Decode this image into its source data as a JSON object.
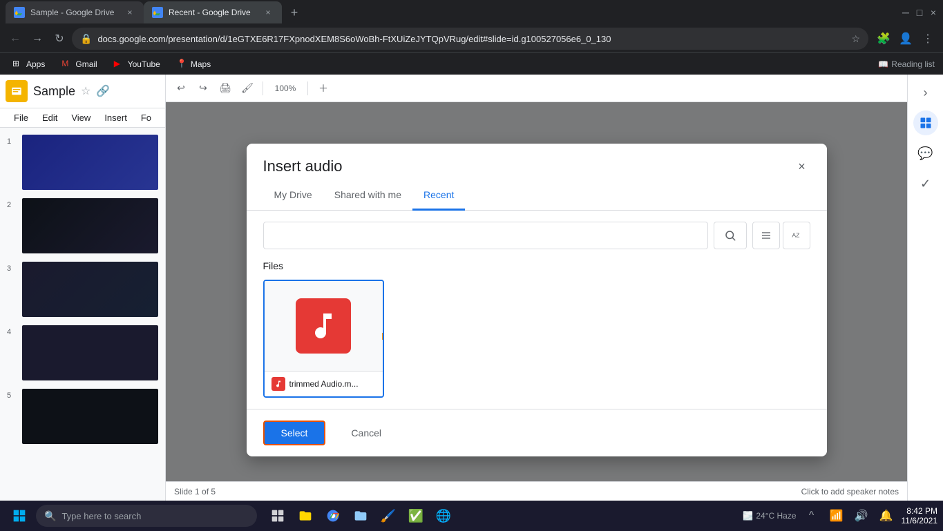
{
  "browser": {
    "tabs": [
      {
        "id": "tab1",
        "title": "Sample - Google Drive",
        "active": false,
        "favicon": "drive"
      },
      {
        "id": "tab2",
        "title": "Recent - Google Drive",
        "active": true,
        "favicon": "drive"
      }
    ],
    "url": "docs.google.com/presentation/d/1eGTXE6R17FXpnodXEM8S6oWoBh-FtXUiZeJYTQpVRug/edit#slide=id.g100527056e6_0_130",
    "bookmarks": [
      {
        "label": "Apps",
        "icon": "grid-icon"
      },
      {
        "label": "Gmail",
        "icon": "gmail-icon"
      },
      {
        "label": "YouTube",
        "icon": "youtube-icon"
      },
      {
        "label": "Maps",
        "icon": "maps-icon"
      }
    ],
    "reading_list": "Reading list"
  },
  "slides": {
    "title": "Sample",
    "menu_items": [
      "File",
      "Edit",
      "View",
      "Insert",
      "Fo"
    ],
    "toolbar": {
      "zoom": "100%"
    },
    "slide_count": 5,
    "current_slide": 1
  },
  "modal": {
    "title": "Insert audio",
    "close_label": "×",
    "tabs": [
      {
        "id": "my-drive",
        "label": "My Drive",
        "active": false
      },
      {
        "id": "shared",
        "label": "Shared with me",
        "active": false
      },
      {
        "id": "recent",
        "label": "Recent",
        "active": true
      }
    ],
    "search": {
      "placeholder": "",
      "search_button_icon": "search-icon"
    },
    "files_label": "Files",
    "files": [
      {
        "id": "file1",
        "name": "trimmed Audio.m...",
        "icon": "audio-icon",
        "selected": true
      }
    ],
    "footer": {
      "select_label": "Select",
      "cancel_label": "Cancel"
    }
  },
  "taskbar": {
    "search_placeholder": "Type here to search",
    "time": "8:42 PM",
    "date": "11/6/2021",
    "weather": "24°C Haze",
    "icons": [
      "task-view-icon",
      "file-explorer-icon",
      "chrome-icon",
      "folder-icon",
      "paint-icon",
      "todo-icon",
      "browser-icon"
    ]
  }
}
